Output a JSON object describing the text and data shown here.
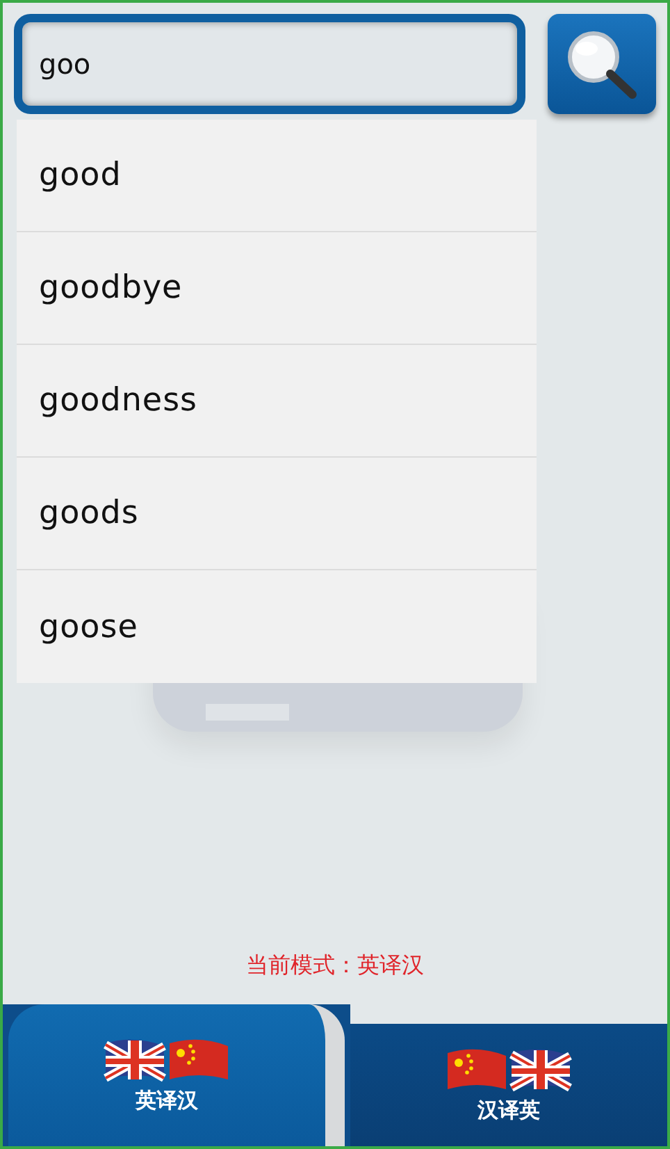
{
  "search": {
    "value": "goo"
  },
  "suggestions": [
    {
      "text": "good"
    },
    {
      "text": "goodbye"
    },
    {
      "text": "goodness"
    },
    {
      "text": "goods"
    },
    {
      "text": "goose"
    }
  ],
  "mode_text": "当前模式：英译汉",
  "tabs": [
    {
      "label": "英译汉",
      "selected": true,
      "flags": [
        {
          "kind": "uk"
        },
        {
          "kind": "cn"
        }
      ]
    },
    {
      "label": "汉译英",
      "selected": false,
      "flags": [
        {
          "kind": "cn"
        },
        {
          "kind": "uk"
        }
      ]
    }
  ]
}
